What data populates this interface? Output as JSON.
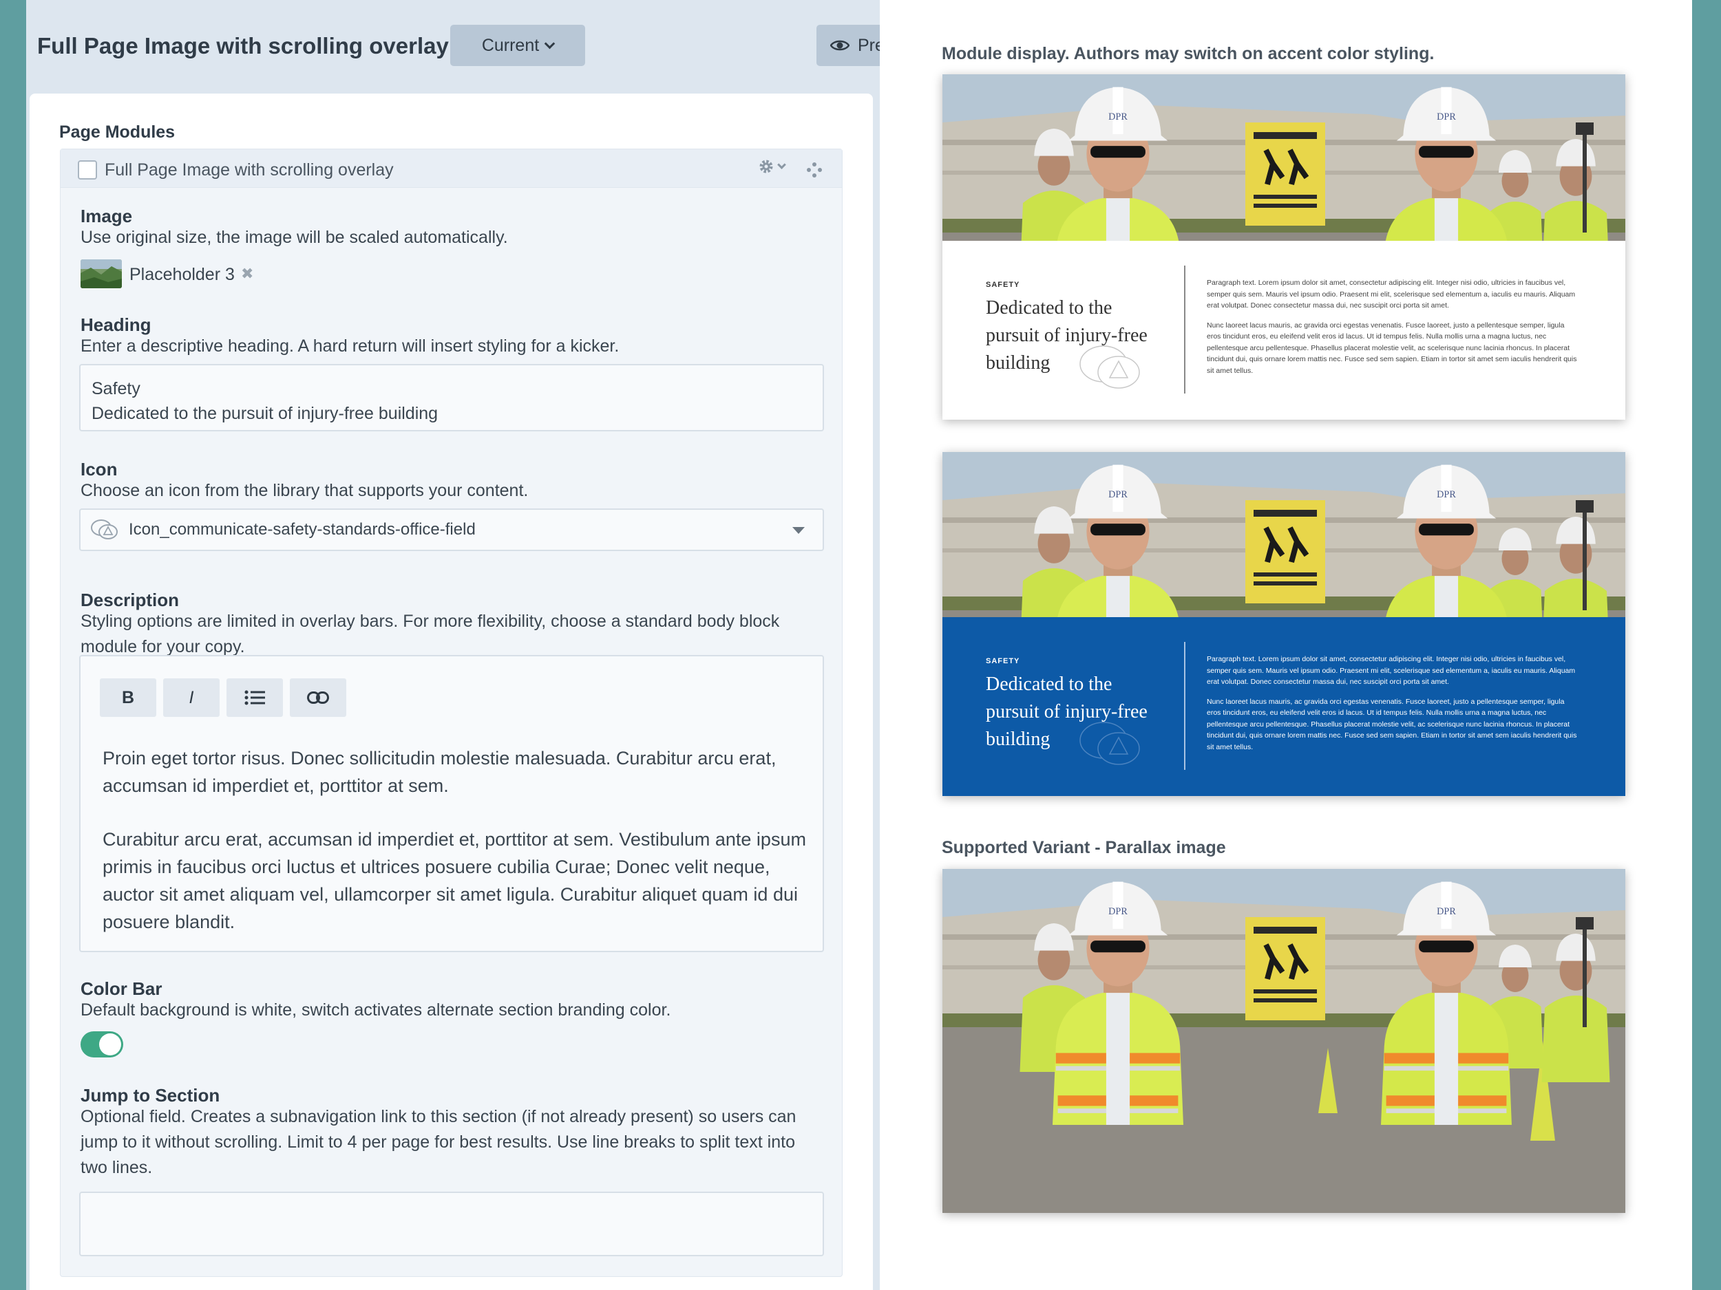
{
  "header": {
    "title": "Full Page Image with scrolling overlay",
    "version_label": "Current",
    "preview_label": "Pre"
  },
  "modules": {
    "section_label": "Page Modules",
    "module_title": "Full Page Image with scrolling overlay",
    "image": {
      "label": "Image",
      "help": "Use original size, the image will be scaled automatically.",
      "file_name": "Placeholder 3",
      "remove_glyph": "✖"
    },
    "heading": {
      "label": "Heading",
      "help": "Enter a descriptive heading. A hard return will insert styling for a kicker.",
      "line1": "Safety",
      "line2": "Dedicated to the pursuit of injury-free building"
    },
    "icon": {
      "label": "Icon",
      "help": "Choose an icon from the library that supports your content.",
      "selected": "Icon_communicate-safety-standards-office-field"
    },
    "description": {
      "label": "Description",
      "help": "Styling options are limited in overlay bars. For more flexibility, choose a standard body block module for your copy.",
      "toolbar": {
        "bold": "B",
        "italic": "I"
      },
      "para1": "Proin eget tortor risus. Donec sollicitudin molestie malesuada. Curabitur arcu erat, accumsan id imperdiet et, porttitor at sem.",
      "para2": "Curabitur arcu erat, accumsan id imperdiet et, porttitor at sem. Vestibulum ante ipsum primis in faucibus orci luctus et ultrices posuere cubilia Curae; Donec velit neque, auctor sit amet aliquam vel, ullamcorper sit amet ligula. Curabitur aliquet quam id dui posuere blandit."
    },
    "color_bar": {
      "label": "Color Bar",
      "help": "Default background is white, switch activates alternate section branding color.",
      "enabled": true,
      "on_color": "#3ea885"
    },
    "jump": {
      "label": "Jump to Section",
      "help": "Optional field. Creates a subnavigation link to this section (if not already present) so users can jump to it without scrolling. Limit to 4 per page for best results. Use line breaks to split text into two lines.",
      "value": ""
    }
  },
  "preview": {
    "caption1": "Module display. Authors may switch on accent color styling.",
    "caption2": "Supported Variant - Parallax image",
    "accent_color": "#0d5aa7",
    "overlay": {
      "kicker": "SAFETY",
      "title": "Dedicated to the pursuit of injury-free building",
      "para1": "Paragraph text. Lorem ipsum dolor sit amet, consectetur adipiscing elit. Integer nisi odio, ultricies in faucibus vel, semper quis sem. Mauris vel ipsum odio. Praesent mi elit, scelerisque sed elementum a, iaculis eu mauris. Aliquam erat volutpat. Donec consectetur massa dui, nec suscipit orci porta sit amet.",
      "para2": "Nunc laoreet lacus mauris, ac gravida orci egestas venenatis. Fusce laoreet, justo a pellentesque semper, ligula eros tincidunt eros, eu eleifend velit eros id lacus. Ut id tempus felis. Nulla mollis urna a magna luctus, nec pellentesque arcu pellentesque. Phasellus placerat molestie velit, ac scelerisque nunc lacinia rhoncus. In placerat tincidunt dui, quis ornare lorem mattis nec. Fusce sed sem sapien. Etiam in tortor sit amet sem iaculis hendrerit quis sit amet tellus."
    },
    "helmet_logo": "DPR"
  }
}
